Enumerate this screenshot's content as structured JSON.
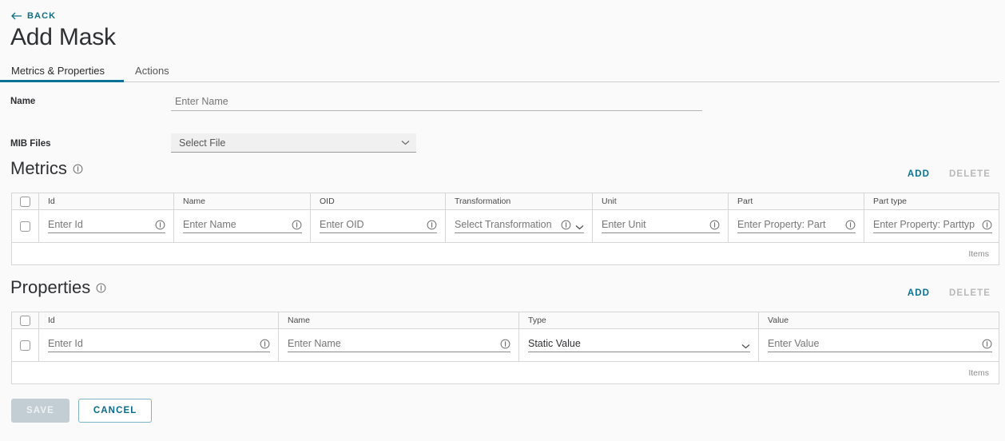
{
  "nav": {
    "back_label": "BACK",
    "back_icon": "arrow-left-icon"
  },
  "header": {
    "title": "Add Mask"
  },
  "tabs": [
    {
      "label": "Metrics & Properties",
      "active": true
    },
    {
      "label": "Actions",
      "active": false
    }
  ],
  "form": {
    "name": {
      "label": "Name",
      "placeholder": "Enter Name",
      "value": ""
    },
    "mib_files": {
      "label": "MIB Files",
      "selected": "Select File",
      "icon": "chevron-down-icon"
    }
  },
  "metrics": {
    "title": "Metrics",
    "info_icon": "info-icon",
    "add_label": "ADD",
    "delete_label": "DELETE",
    "delete_disabled": true,
    "columns": [
      "Id",
      "Name",
      "OID",
      "Transformation",
      "Unit",
      "Part",
      "Part type"
    ],
    "row": {
      "id": {
        "placeholder": "Enter Id",
        "value": "",
        "info_icon": "info-icon"
      },
      "name": {
        "placeholder": "Enter Name",
        "value": "",
        "info_icon": "info-icon"
      },
      "oid": {
        "placeholder": "Enter OID",
        "value": "",
        "info_icon": "info-icon"
      },
      "transformation": {
        "placeholder": "Select Transformation",
        "value": "",
        "info_icon": "info-icon",
        "chevron_icon": "chevron-down-icon"
      },
      "unit": {
        "placeholder": "Enter Unit",
        "value": "",
        "info_icon": "info-icon"
      },
      "part": {
        "placeholder": "Enter Property: Part",
        "value": "",
        "info_icon": "info-icon"
      },
      "part_type": {
        "placeholder": "Enter Property: Parttyp",
        "value": "",
        "info_icon": "info-icon"
      }
    },
    "footer_label": "Items"
  },
  "properties": {
    "title": "Properties",
    "info_icon": "info-icon",
    "add_label": "ADD",
    "delete_label": "DELETE",
    "delete_disabled": true,
    "columns": [
      "Id",
      "Name",
      "Type",
      "Value"
    ],
    "row": {
      "id": {
        "placeholder": "Enter Id",
        "value": "",
        "info_icon": "info-icon"
      },
      "name": {
        "placeholder": "Enter Name",
        "value": "",
        "info_icon": "info-icon"
      },
      "type": {
        "placeholder": "Static Value",
        "value": "Static Value",
        "chevron_icon": "chevron-down-icon"
      },
      "value": {
        "placeholder": "Enter Value",
        "value": "",
        "info_icon": "info-icon"
      }
    },
    "footer_label": "Items"
  },
  "footer": {
    "save_label": "SAVE",
    "save_disabled": true,
    "cancel_label": "CANCEL"
  },
  "colors": {
    "accent": "#0a7296",
    "link": "#0f6e84",
    "page_bg": "#fafafa",
    "grid_border": "#d6d6d6",
    "disabled": "#b9b9b9",
    "save_disabled_bg": "#c3ced4"
  }
}
